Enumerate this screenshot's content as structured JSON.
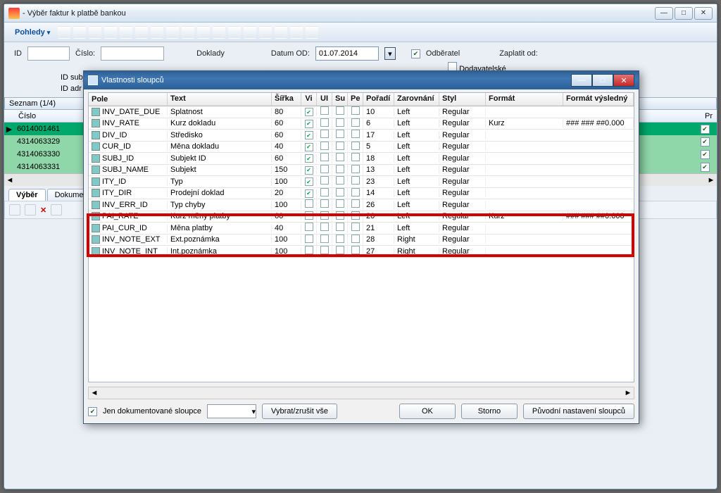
{
  "outer": {
    "title": " - Výběr faktur k platbě bankou",
    "pohledy": "Pohledy",
    "labels": {
      "id": "ID",
      "cislo": "Číslo:",
      "doklady": "Doklady",
      "datum_od": "Datum OD:",
      "odberatel": "Odběratel",
      "dodavatel": "Dodavatelské",
      "zaplatit": "Zaplatit od:",
      "idsubj": "ID subj",
      "idadr": "ID adr"
    },
    "date": "01.07.2014",
    "seznam": "Seznam (1/4)",
    "col_cislo": "Číslo",
    "col_pr": "Pr",
    "rows": [
      {
        "cislo": "6014001461",
        "sel": true,
        "ptr": true
      },
      {
        "cislo": "4314063329"
      },
      {
        "cislo": "4314063330"
      },
      {
        "cislo": "4314063331"
      }
    ],
    "tabs": {
      "vyber": "Výběr",
      "dokument": "Dokument -"
    }
  },
  "modal": {
    "title": "Vlastnosti sloupců",
    "headers": {
      "pole": "Pole",
      "text": "Text",
      "sirka": "Šířka",
      "vi": "Vi",
      "ui": "UI",
      "su": "Su",
      "pe": "Pe",
      "poradi": "Pořadí",
      "zarov": "Zarovnání",
      "styl": "Styl",
      "format": "Formát",
      "formatv": "Formát výsledný"
    },
    "rows": [
      {
        "pole": "INV_DATE_DUE",
        "text": "Splatnost",
        "sirka": "80",
        "vi": true,
        "por": "10",
        "zar": "Left",
        "styl": "Regular",
        "fmt": "",
        "fmtv": ""
      },
      {
        "pole": "INV_RATE",
        "text": "Kurz dokladu",
        "sirka": "60",
        "vi": true,
        "por": "6",
        "zar": "Left",
        "styl": "Regular",
        "fmt": "Kurz",
        "fmtv": "### ### ##0.000"
      },
      {
        "pole": "DIV_ID",
        "text": "Středisko",
        "sirka": "60",
        "vi": true,
        "por": "17",
        "zar": "Left",
        "styl": "Regular",
        "fmt": "",
        "fmtv": ""
      },
      {
        "pole": "CUR_ID",
        "text": "Měna dokladu",
        "sirka": "40",
        "vi": true,
        "por": "5",
        "zar": "Left",
        "styl": "Regular",
        "fmt": "",
        "fmtv": ""
      },
      {
        "pole": "SUBJ_ID",
        "text": "Subjekt ID",
        "sirka": "60",
        "vi": true,
        "por": "18",
        "zar": "Left",
        "styl": "Regular",
        "fmt": "",
        "fmtv": ""
      },
      {
        "pole": "SUBJ_NAME",
        "text": "Subjekt",
        "sirka": "150",
        "vi": true,
        "por": "13",
        "zar": "Left",
        "styl": "Regular",
        "fmt": "",
        "fmtv": ""
      },
      {
        "pole": "ITY_ID",
        "text": "Typ",
        "sirka": "100",
        "vi": true,
        "por": "23",
        "zar": "Left",
        "styl": "Regular",
        "fmt": "",
        "fmtv": ""
      },
      {
        "pole": "ITY_DIR",
        "text": "Prodejní doklad",
        "sirka": "20",
        "vi": true,
        "por": "14",
        "zar": "Left",
        "styl": "Regular",
        "fmt": "",
        "fmtv": ""
      },
      {
        "pole": "INV_ERR_ID",
        "text": "Typ chyby",
        "sirka": "100",
        "vi": false,
        "por": "26",
        "zar": "Left",
        "styl": "Regular",
        "fmt": "",
        "fmtv": ""
      },
      {
        "pole": "PAI_RATE",
        "text": "Kurz měny platby",
        "sirka": "60",
        "vi": false,
        "por": "20",
        "zar": "Left",
        "styl": "Regular",
        "fmt": "Kurz",
        "fmtv": "### ### ##0.000"
      },
      {
        "pole": "PAI_CUR_ID",
        "text": "Měna platby",
        "sirka": "40",
        "vi": false,
        "por": "21",
        "zar": "Left",
        "styl": "Regular",
        "fmt": "",
        "fmtv": ""
      },
      {
        "pole": "INV_NOTE_EXT",
        "text": "Ext.poznámka",
        "sirka": "100",
        "vi": false,
        "por": "28",
        "zar": "Right",
        "styl": "Regular",
        "fmt": "",
        "fmtv": ""
      },
      {
        "pole": "INV_NOTE_INT",
        "text": "Int.poznámka",
        "sirka": "100",
        "vi": false,
        "por": "27",
        "zar": "Right",
        "styl": "Regular",
        "fmt": "",
        "fmtv": ""
      }
    ],
    "footer": {
      "jen_dok": "Jen dokumentované sloupce",
      "vybrat": "Vybrat/zrušit vše",
      "ok": "OK",
      "storno": "Storno",
      "puvodni": "Původní nastavení sloupců"
    }
  }
}
